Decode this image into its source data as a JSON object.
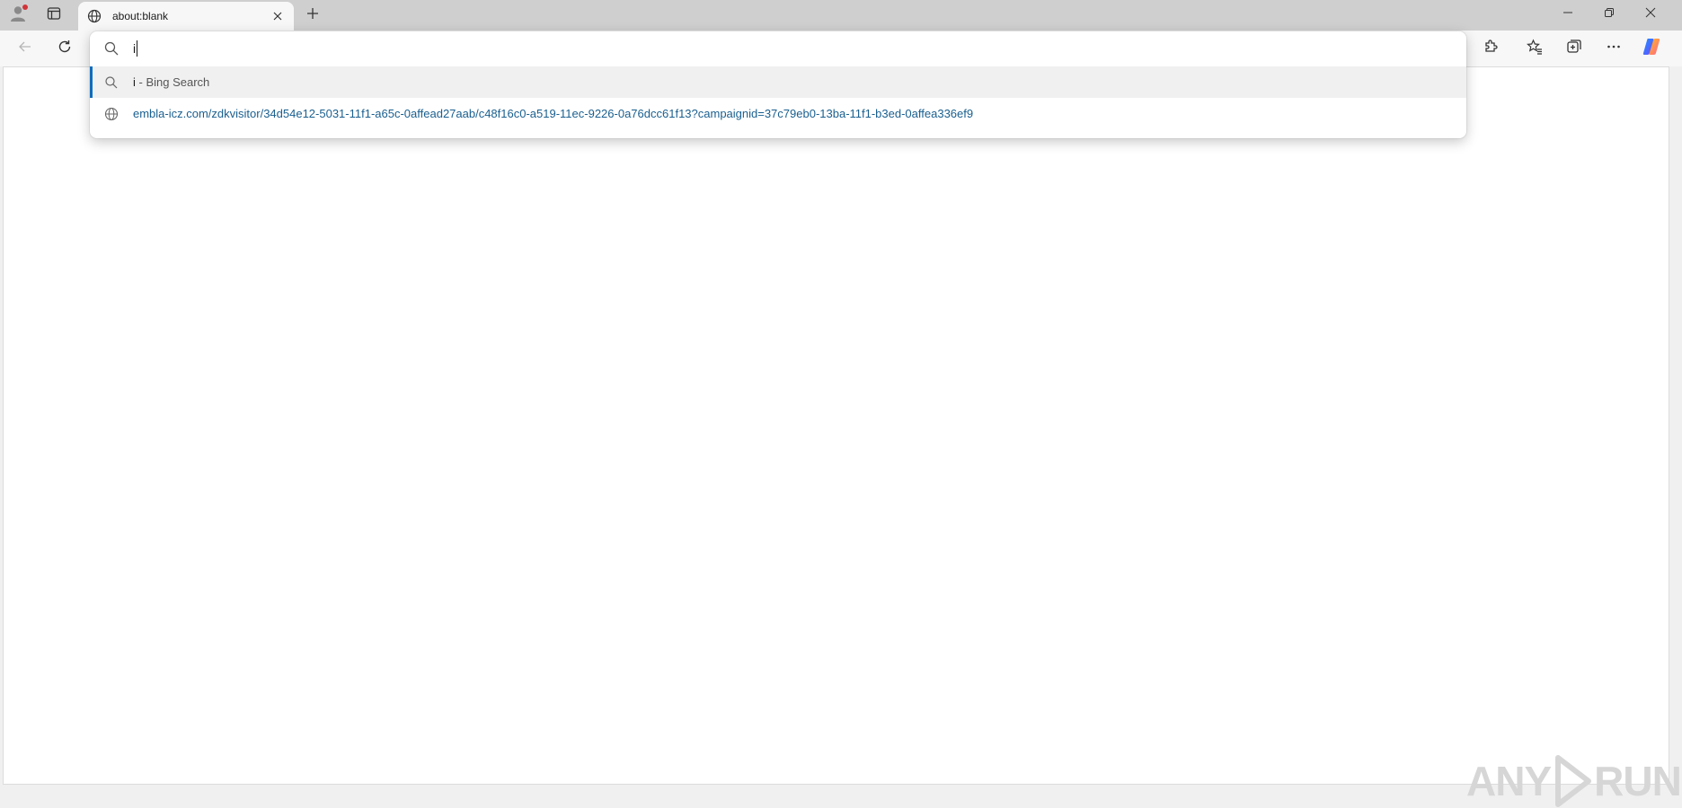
{
  "tabstrip": {
    "tab": {
      "title": "about:blank",
      "favicon": "globe-icon"
    },
    "buttons": [
      "profile-icon",
      "tab-actions-icon",
      "new-tab-icon"
    ],
    "window_controls": [
      "minimize-icon",
      "restore-icon",
      "close-icon"
    ]
  },
  "toolbar": {
    "left_buttons": [
      "back-arrow-icon",
      "refresh-icon"
    ],
    "right_buttons": [
      "extensions-icon",
      "favorites-icon",
      "collections-icon",
      "more-icon",
      "copilot-icon"
    ]
  },
  "omnibox": {
    "value": "i",
    "suggestions": [
      {
        "query": "i",
        "suffix": " - Bing Search",
        "icon": "search-icon",
        "selected": true
      },
      {
        "text": "embla-icz.com/zdkvisitor/34d54e12-5031-11f1-a65c-0affead27aab/c48f16c0-a519-11ec-9226-0a76dcc61f13?campaignid=37c79eb0-13ba-11f1-b3ed-0affea336ef9",
        "icon": "globe-icon"
      }
    ]
  },
  "watermark": {
    "text_left": "ANY",
    "text_right": "RUN"
  },
  "colors": {
    "accent": "#0f6cbd",
    "tabstrip_bg": "#cfcfcf",
    "toolbar_bg": "#f7f7f7",
    "notification_dot": "#d13438"
  }
}
